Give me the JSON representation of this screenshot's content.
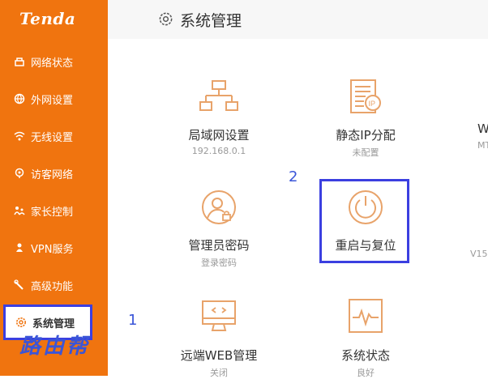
{
  "brand": {
    "logo_text": "Tenda",
    "accent": "#f0740f",
    "annotation_color": "#3b3fe0"
  },
  "sidebar": {
    "items": [
      {
        "label": "网络状态",
        "icon": "network-status-icon"
      },
      {
        "label": "外网设置",
        "icon": "globe-icon"
      },
      {
        "label": "无线设置",
        "icon": "wifi-icon"
      },
      {
        "label": "访客网络",
        "icon": "guest-network-icon"
      },
      {
        "label": "家长控制",
        "icon": "parental-control-icon"
      },
      {
        "label": "VPN服务",
        "icon": "vpn-icon"
      },
      {
        "label": "高级功能",
        "icon": "tools-icon"
      },
      {
        "label": "系统管理",
        "icon": "gear-icon",
        "active": true
      }
    ]
  },
  "header": {
    "title": "系统管理",
    "icon": "gear-icon"
  },
  "tiles": [
    {
      "label": "局域网设置",
      "sub": "192.168.0.1",
      "icon": "lan-icon"
    },
    {
      "label": "静态IP分配",
      "sub": "未配置",
      "icon": "static-ip-icon"
    },
    {
      "label": "管理员密码",
      "sub": "登录密码",
      "icon": "admin-password-icon"
    },
    {
      "label": "重启与复位",
      "sub": "",
      "icon": "power-icon"
    },
    {
      "label": "远端WEB管理",
      "sub": "关闭",
      "icon": "remote-web-icon"
    },
    {
      "label": "系统状态",
      "sub": "良好",
      "icon": "system-status-icon"
    }
  ],
  "partial_column": {
    "label_top": "W",
    "sub_top": "MT",
    "sub_mid": "V15"
  },
  "annotations": {
    "marker_1": "1",
    "marker_2": "2"
  },
  "watermark": "路由帮"
}
